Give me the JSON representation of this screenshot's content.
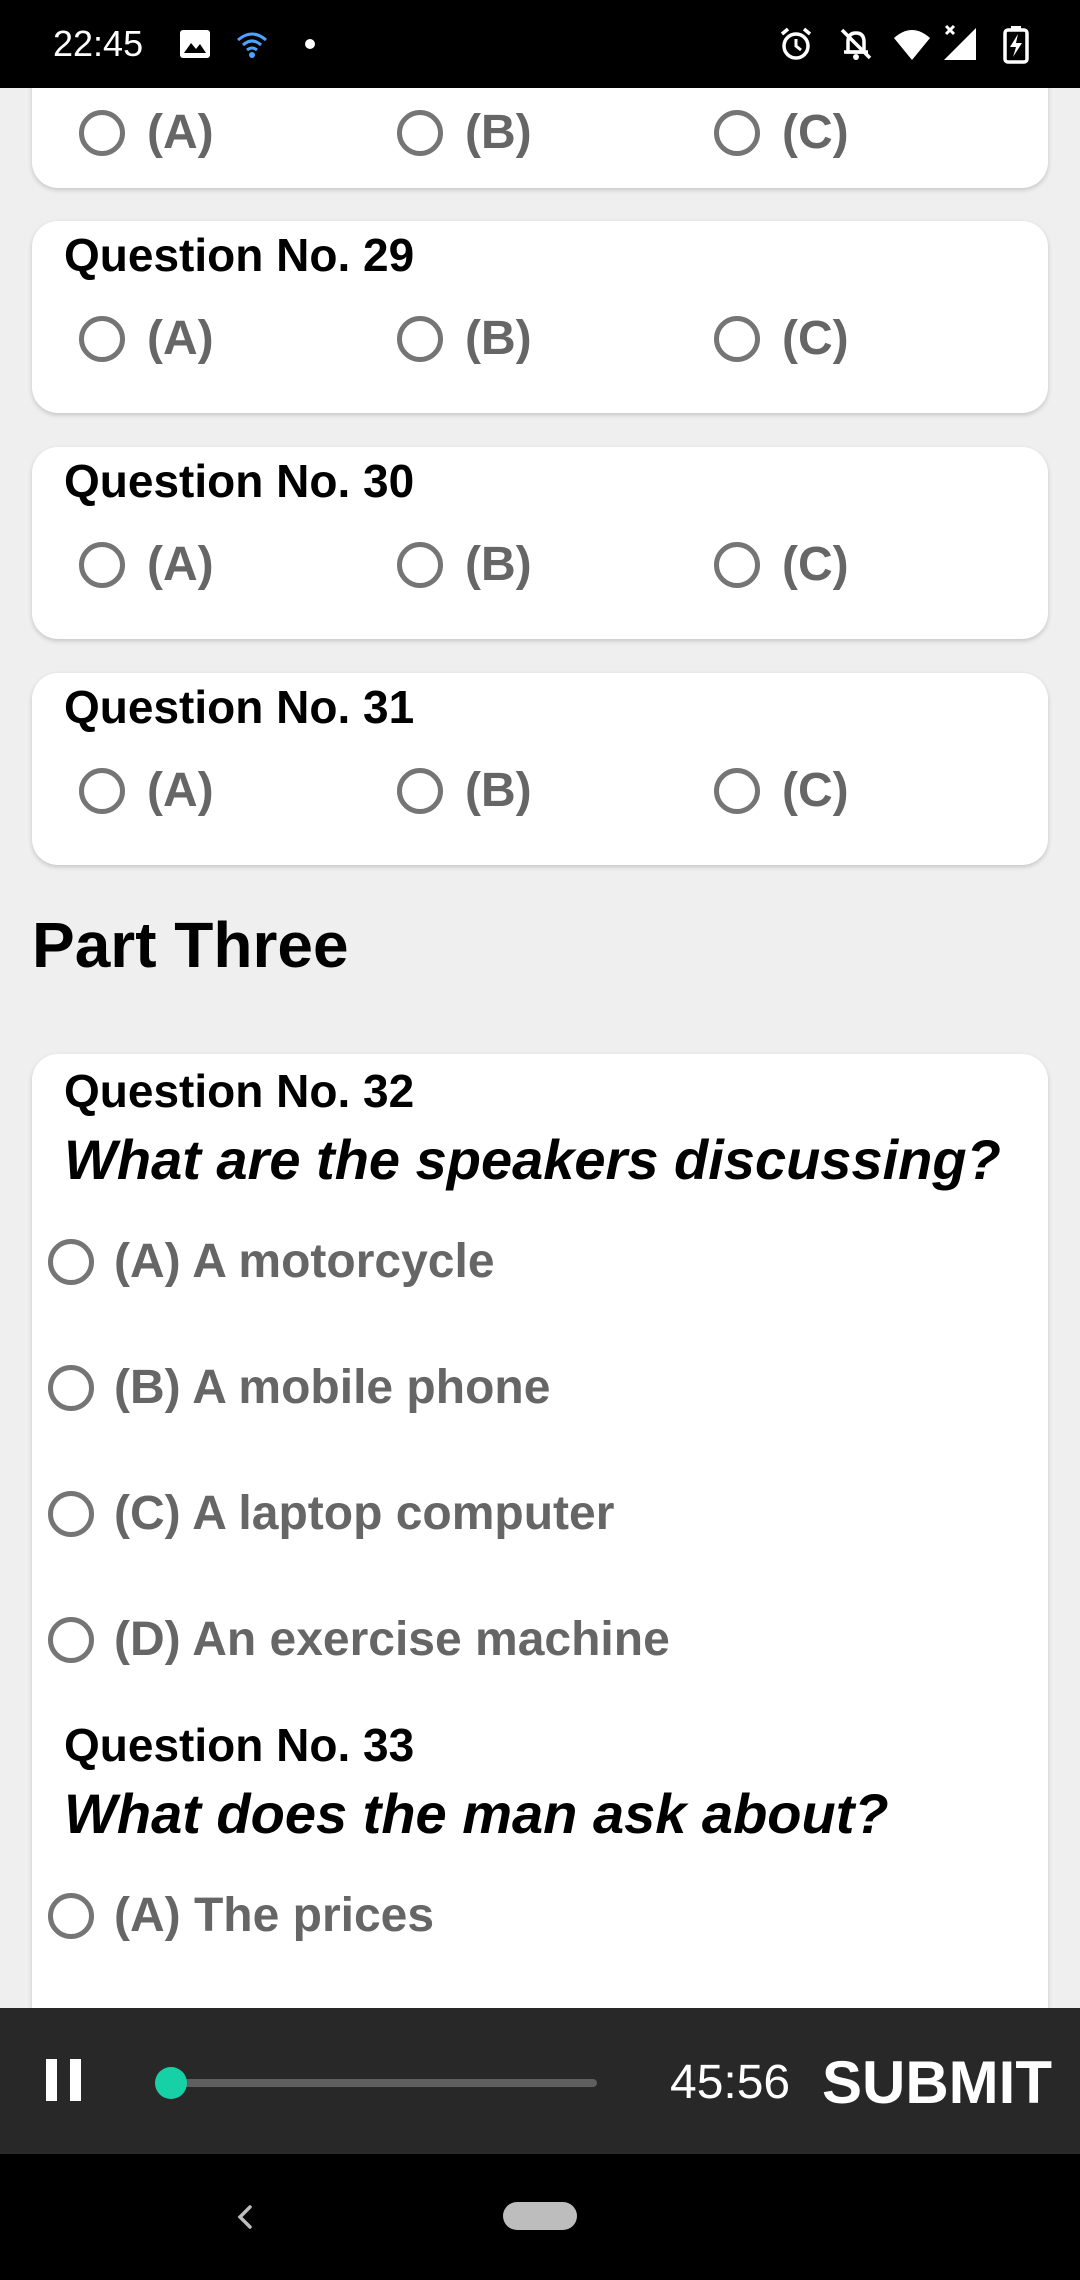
{
  "status_bar": {
    "time": "22:45",
    "icons_left": [
      "image-icon",
      "wifi-calling-icon",
      "dot-icon"
    ],
    "icons_right": [
      "alarm-icon",
      "notifications-off-icon",
      "wifi-icon",
      "signal-icon",
      "battery-charging-icon"
    ]
  },
  "questions_part2": [
    {
      "options": [
        "(A)",
        "(B)",
        "(C)"
      ]
    },
    {
      "title": "Question No. 29",
      "options": [
        "(A)",
        "(B)",
        "(C)"
      ]
    },
    {
      "title": "Question No. 30",
      "options": [
        "(A)",
        "(B)",
        "(C)"
      ]
    },
    {
      "title": "Question No. 31",
      "options": [
        "(A)",
        "(B)",
        "(C)"
      ]
    }
  ],
  "part_heading": "Part Three",
  "part3": {
    "q32": {
      "title": "Question No. 32",
      "text": "What are the speakers discussing?",
      "options": [
        "(A) A motorcycle",
        "(B) A mobile phone",
        "(C) A laptop computer",
        "(D) An exercise machine"
      ]
    },
    "q33": {
      "title": "Question No. 33",
      "text": "What does the man ask about?",
      "options": [
        "(A) The prices"
      ]
    }
  },
  "player": {
    "time": "45:56",
    "submit_label": "SUBMIT",
    "progress": 0.0,
    "accent_color": "#17d1a6"
  }
}
